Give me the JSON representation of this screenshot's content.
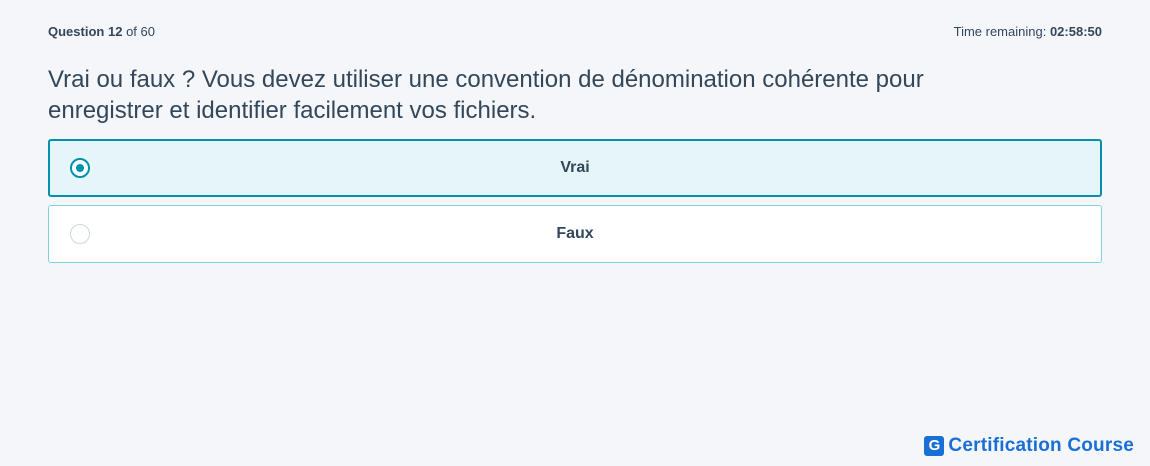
{
  "header": {
    "question_label": "Question",
    "question_number": "12",
    "question_of": "of 60",
    "time_label": "Time remaining:",
    "time_value": "02:58:50"
  },
  "question": {
    "text": "Vrai ou faux ? Vous devez utiliser une convention de dénomination cohérente pour enregistrer et identifier facilement vos fichiers."
  },
  "options": [
    {
      "label": "Vrai",
      "selected": true
    },
    {
      "label": "Faux",
      "selected": false
    }
  ],
  "brand": {
    "logo_letter": "G",
    "name": "Certification Course",
    "color": "#1a6fd6"
  },
  "colors": {
    "accent": "#0091ae",
    "selected_bg": "#e5f5f8",
    "text": "#33475b",
    "background": "#f4f6fa"
  }
}
